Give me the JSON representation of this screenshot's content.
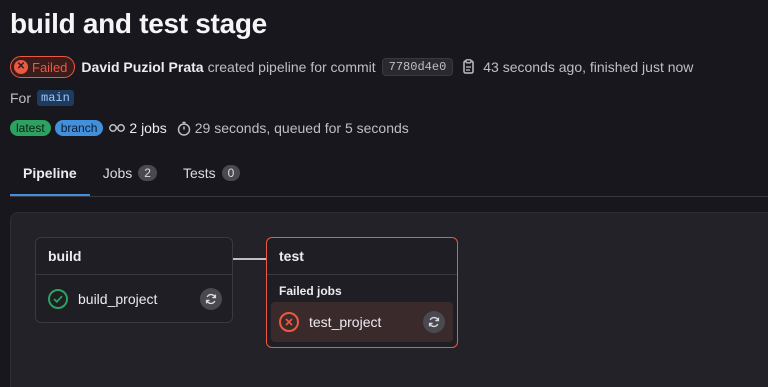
{
  "page": {
    "title": "build and test stage"
  },
  "meta": {
    "status": "Failed",
    "author": "David Puziol Prata",
    "created_text": "created pipeline for commit",
    "commit_sha": "7780d4e0",
    "time_text": "43 seconds ago, finished just now",
    "for_label": "For",
    "branch": "main",
    "tags": [
      "latest",
      "branch"
    ],
    "jobs_count": "2 jobs",
    "duration": "29 seconds, queued for 5 seconds"
  },
  "tabs": [
    {
      "label": "Pipeline",
      "active": true
    },
    {
      "label": "Jobs",
      "count": "2"
    },
    {
      "label": "Tests",
      "count": "0"
    }
  ],
  "graph": {
    "stages": [
      {
        "name": "build",
        "jobs": [
          {
            "name": "build_project",
            "status": "success"
          }
        ]
      },
      {
        "name": "test",
        "group_label": "Failed jobs",
        "jobs": [
          {
            "name": "test_project",
            "status": "failed"
          }
        ]
      }
    ]
  },
  "colors": {
    "failed": "#ec5941",
    "success": "#2da160",
    "accent": "#428fdc"
  }
}
